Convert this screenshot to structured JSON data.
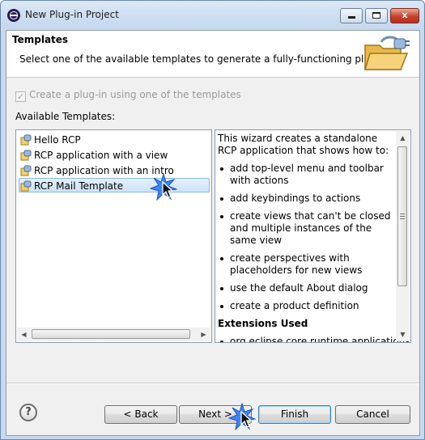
{
  "window": {
    "title": "New Plug-in Project",
    "minimize_label": "",
    "maximize_label": "",
    "close_label": "x"
  },
  "header": {
    "title": "Templates",
    "description": "Select one of the available templates to generate a fully-functioning plug-in."
  },
  "options": {
    "use_template_label": "Create a plug-in using one of the templates",
    "use_template_checked": true,
    "available_label": "Available Templates:"
  },
  "templates": [
    {
      "label": "Hello RCP",
      "selected": false
    },
    {
      "label": "RCP application with a view",
      "selected": false
    },
    {
      "label": "RCP application with an intro",
      "selected": false
    },
    {
      "label": "RCP Mail Template",
      "selected": true
    }
  ],
  "description_panel": {
    "intro": "This wizard creates a standalone RCP application that shows how to:",
    "bullets": [
      "add top-level menu and toolbar with actions",
      "add keybindings to actions",
      "create views that can't be closed and multiple instances of the same view",
      "create perspectives with placeholders for new views",
      "use the default About dialog",
      "create a product definition"
    ],
    "extensions_heading": "Extensions Used",
    "extensions": [
      "org.eclipse.core.runtime.applications"
    ]
  },
  "buttons": {
    "help": "?",
    "back": "< Back",
    "next": "Next >",
    "finish": "Finish",
    "cancel": "Cancel"
  },
  "icons": {
    "app": "eclipse-icon",
    "header": "plugin-folder-icon",
    "template": "plugin-template-icon",
    "cursor": "mouse-pointer-icon"
  },
  "colors": {
    "selection": "#cde3f7",
    "highlight_cursor": "#2a6ce0"
  }
}
